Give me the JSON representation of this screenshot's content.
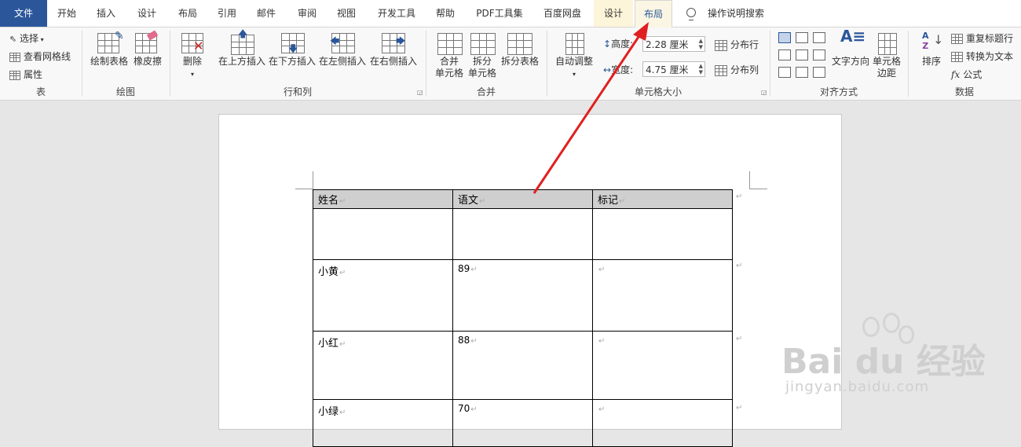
{
  "tabs": [
    "文件",
    "开始",
    "插入",
    "设计",
    "布局",
    "引用",
    "邮件",
    "审阅",
    "视图",
    "开发工具",
    "帮助",
    "PDF工具集",
    "百度网盘",
    "设计",
    "布局",
    "操作说明搜索"
  ],
  "ribbon": {
    "table_group": {
      "label": "表",
      "select": "选择",
      "view_grid": "查看网格线",
      "properties": "属性"
    },
    "draw_group": {
      "label": "绘图",
      "draw_table": "绘制表格",
      "eraser": "橡皮擦"
    },
    "rows_group": {
      "label": "行和列",
      "delete": "删除",
      "insert_above": "在上方插入",
      "insert_below": "在下方插入",
      "insert_left": "在左侧插入",
      "insert_right": "在右侧插入"
    },
    "merge_group": {
      "label": "合并",
      "merge_cells": "合并单元格",
      "merge_l1": "合并",
      "merge_l2": "单元格",
      "split_l1": "拆分",
      "split_l2": "单元格",
      "split_table": "拆分表格"
    },
    "size_group": {
      "label": "单元格大小",
      "autofit": "自动调整",
      "height_label": "高度:",
      "height_value": "2.28 厘米",
      "width_label": "宽度:",
      "width_value": "4.75 厘米",
      "dist_rows": "分布行",
      "dist_cols": "分布列"
    },
    "align_group": {
      "label": "对齐方式",
      "text_dir": "文字方向",
      "margin_l1": "单元格",
      "margin_l2": "边距"
    },
    "data_group": {
      "label": "数据",
      "sort": "排序",
      "repeat_header": "重复标题行",
      "to_text": "转换为文本",
      "formula": "公式"
    }
  },
  "table": {
    "header": [
      "姓名",
      "语文",
      "标记"
    ],
    "rows": [
      [
        "小黄",
        "89",
        ""
      ],
      [
        "小红",
        "88",
        ""
      ],
      [
        "小绿",
        "70",
        ""
      ]
    ]
  },
  "watermark": {
    "brand": "Bai du",
    "cn": "经验",
    "url": "jingyan.baidu.com"
  },
  "colors": {
    "file_tab": "#2b579a",
    "arrow": "#e02020"
  }
}
